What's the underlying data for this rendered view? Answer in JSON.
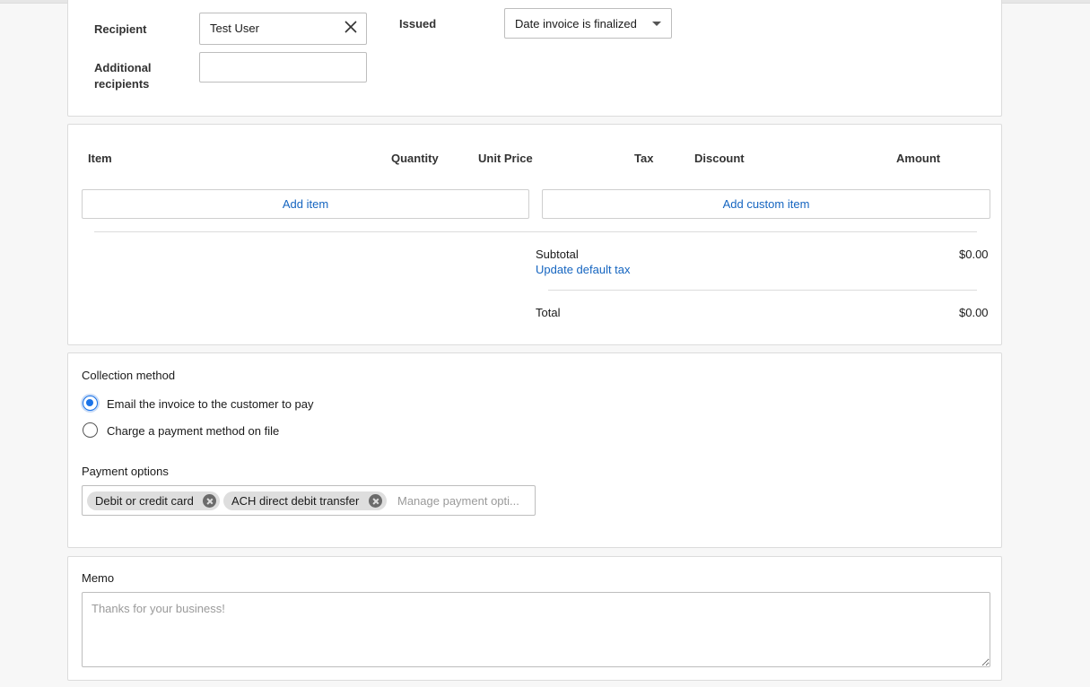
{
  "details": {
    "recipient_label": "Recipient",
    "recipient_value": "Test User",
    "additional_recipients_label_line1": "Additional",
    "additional_recipients_label_line2": "recipients",
    "additional_recipients_value": "",
    "issued_label": "Issued",
    "issued_value": "Date invoice is finalized"
  },
  "items_table": {
    "columns": [
      "Item",
      "Quantity",
      "Unit Price",
      "Tax",
      "Discount",
      "Amount"
    ],
    "add_item_label": "Add item",
    "add_custom_item_label": "Add custom item",
    "subtotal_label": "Subtotal",
    "subtotal_value": "$0.00",
    "update_tax_link": "Update default tax",
    "total_label": "Total",
    "total_value": "$0.00"
  },
  "collection": {
    "title": "Collection method",
    "options": [
      {
        "label": "Email the invoice to the customer to pay",
        "checked": true
      },
      {
        "label": "Charge a payment method on file",
        "checked": false
      }
    ],
    "payment_options_title": "Payment options",
    "payment_chips": [
      "Debit or credit card",
      "ACH direct debit transfer"
    ],
    "payment_placeholder": "Manage payment opti..."
  },
  "memo": {
    "title": "Memo",
    "placeholder": "Thanks for your business!"
  },
  "colors": {
    "link": "#1565c0",
    "radio_accent": "#1a73e8"
  }
}
